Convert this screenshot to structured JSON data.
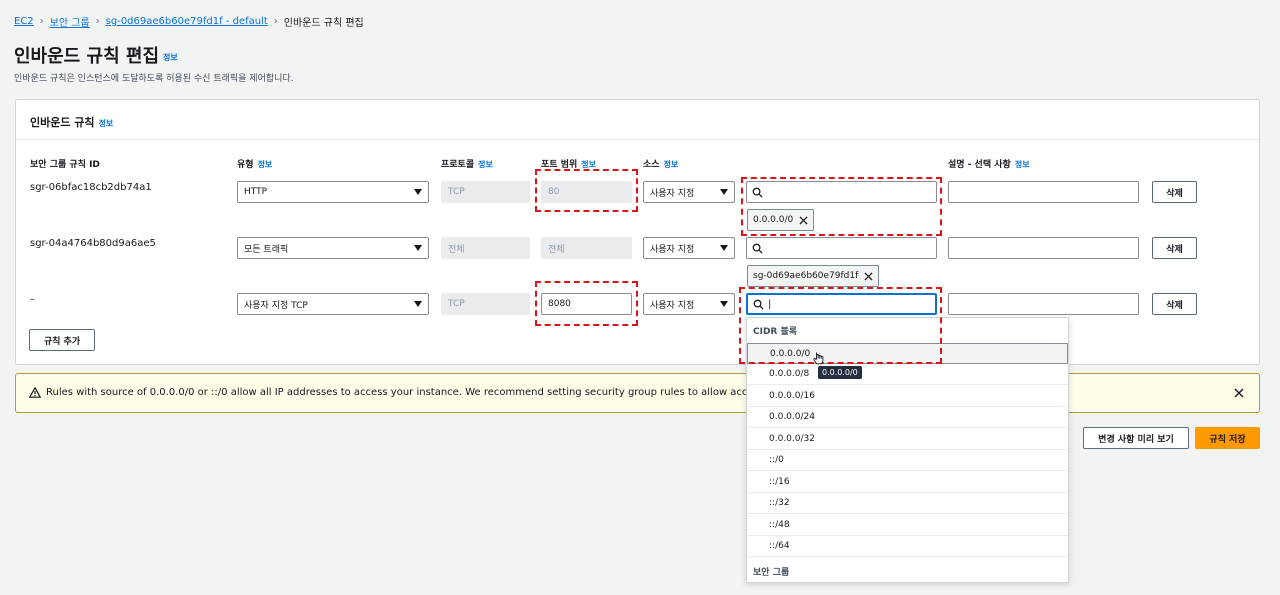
{
  "breadcrumb": {
    "items": [
      "EC2",
      "보안 그룹",
      "sg-0d69ae6b60e79fd1f - default"
    ],
    "current": "인바운드 규칙 편집",
    "separator": "›"
  },
  "page": {
    "title": "인바운드 규칙 편집",
    "info": "정보",
    "description": "인바운드 규칙은 인스턴스에 도달하도록 허용된 수신 트래픽을 제어합니다."
  },
  "panel": {
    "title": "인바운드 규칙",
    "info": "정보",
    "columns": {
      "rule_id": "보안 그룹 규칙 ID",
      "type": "유형",
      "protocol": "프로토콜",
      "port_range": "포트 범위",
      "source": "소스",
      "description": "설명 - 선택 사항"
    },
    "info_link": "정보",
    "rows": [
      {
        "id": "sgr-06bfac18cb2db74a1",
        "type": "HTTP",
        "protocol": "TCP",
        "port": "80",
        "source_type": "사용자 지정",
        "search_value": "",
        "token": "0.0.0.0/0",
        "delete": "삭제"
      },
      {
        "id": "sgr-04a4764b80d9a6ae5",
        "type": "모든 트래픽",
        "protocol": "전체",
        "port": "전체",
        "source_type": "사용자 지정",
        "search_value": "",
        "token": "sg-0d69ae6b60e79fd1f",
        "delete": "삭제"
      },
      {
        "id": "–",
        "type": "사용자 지정 TCP",
        "protocol": "TCP",
        "port": "8080",
        "source_type": "사용자 지정",
        "search_value": "|",
        "token": "",
        "delete": "삭제"
      }
    ],
    "add_rule": "규칙 추가"
  },
  "warning": {
    "text": "Rules with source of 0.0.0.0/0 or ::/0 allow all IP addresses to access your instance. We recommend setting security group rules to allow access from known IP addresses only."
  },
  "dropdown": {
    "group_cidr": "CIDR 블록",
    "items": [
      "0.0.0.0/0",
      "0.0.0.0/8",
      "0.0.0.0/16",
      "0.0.0.0/24",
      "0.0.0.0/32",
      "::/0",
      "::/16",
      "::/32",
      "::/48",
      "::/64"
    ],
    "group_sg": "보안 그룹",
    "tooltip": "0.0.0.0/0"
  },
  "footer": {
    "preview": "변경 사항 미리 보기",
    "save": "규칙 저장"
  },
  "colors": {
    "link": "#0972d3",
    "primary": "#ff9900",
    "highlight": "#d91515",
    "warning_bg": "#fffce8"
  }
}
